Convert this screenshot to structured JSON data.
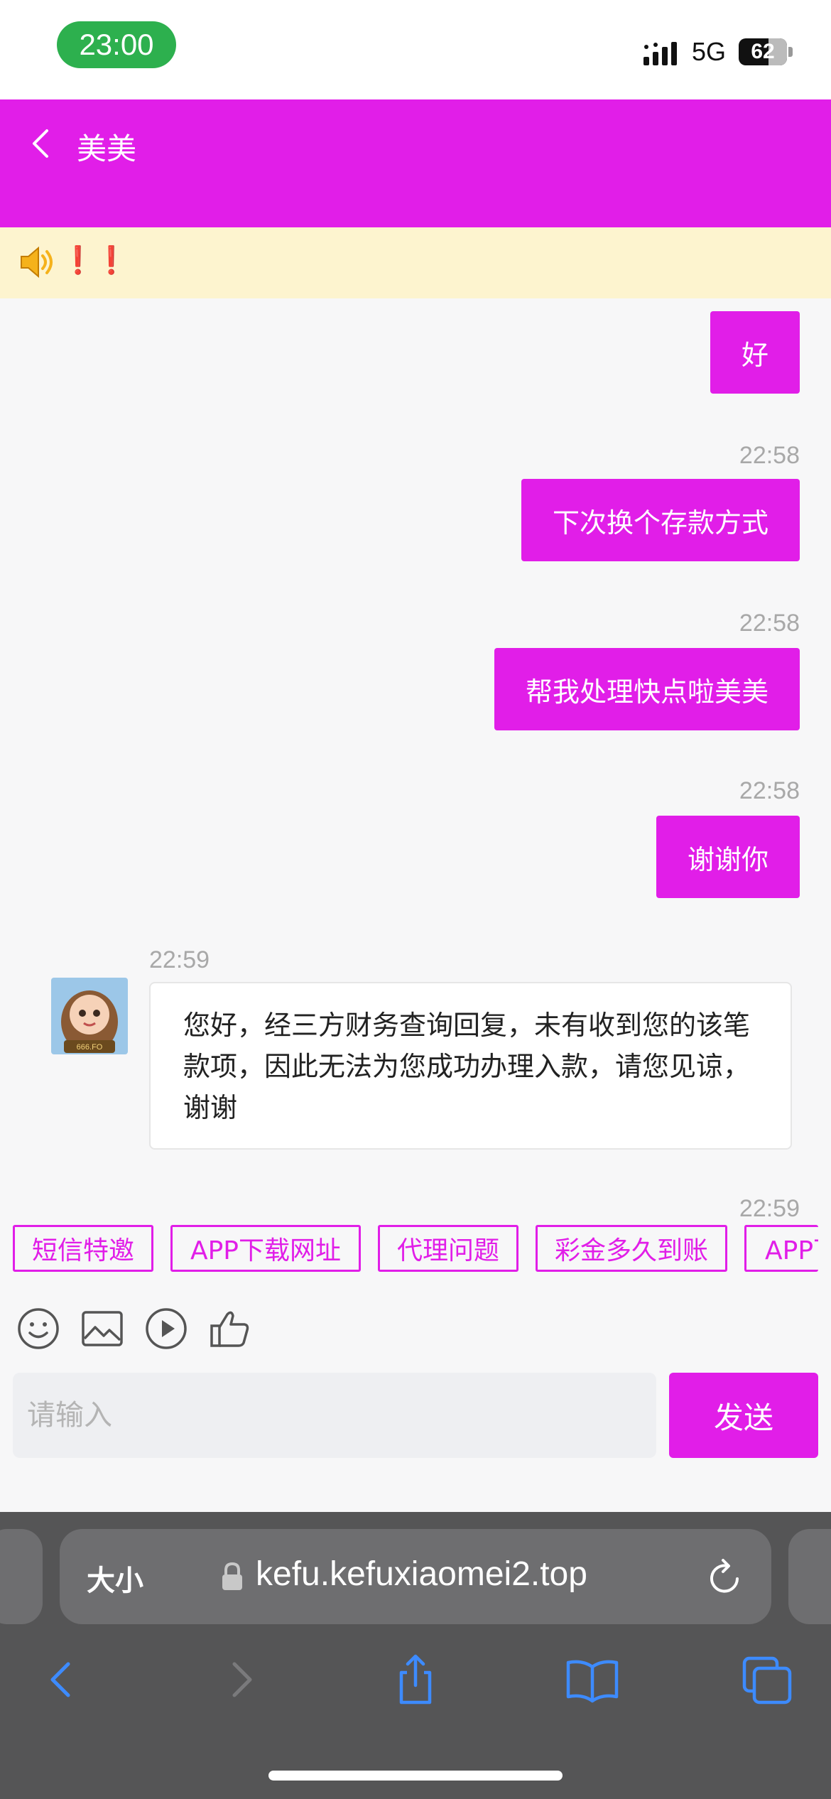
{
  "status_bar": {
    "time": "23:00",
    "network": "5G",
    "battery": "62",
    "battery_level": 0.62
  },
  "header": {
    "title": "美美"
  },
  "notice": {
    "text": "❗❗"
  },
  "messages": [
    {
      "sender": "user",
      "time": "",
      "text": "好"
    },
    {
      "sender": "user",
      "time": "22:58",
      "text": "下次换个存款方式"
    },
    {
      "sender": "user",
      "time": "22:58",
      "text": "帮我处理快点啦美美"
    },
    {
      "sender": "user",
      "time": "22:58",
      "text": "谢谢你"
    },
    {
      "sender": "agent",
      "time": "22:59",
      "text": "您好，经三方财务查询回复，未有收到您的该笔款项，因此无法为您成功办理入款，请您见谅，谢谢",
      "avatar_label": "666.FO"
    },
    {
      "sender": "user",
      "time": "22:59",
      "text": ""
    }
  ],
  "quick_replies": [
    "短信特邀",
    "APP下载网址",
    "代理问题",
    "彩金多久到账",
    "APP下载"
  ],
  "input": {
    "placeholder": "请输入",
    "value": ""
  },
  "send_label": "发送",
  "browser": {
    "aa_label": "大小",
    "url": "kefu.kefuxiaomei2.top"
  },
  "colors": {
    "accent": "#e11ee8",
    "notice_bg": "#fdf4cf",
    "browser_bg": "#555556",
    "link_blue": "#3d8bff"
  },
  "toolbar_icons": [
    "emoji-icon",
    "image-icon",
    "video-icon",
    "thumbs-up-icon"
  ],
  "browser_icons": [
    "back-icon",
    "forward-icon",
    "share-icon",
    "bookmarks-icon",
    "tabs-icon"
  ]
}
